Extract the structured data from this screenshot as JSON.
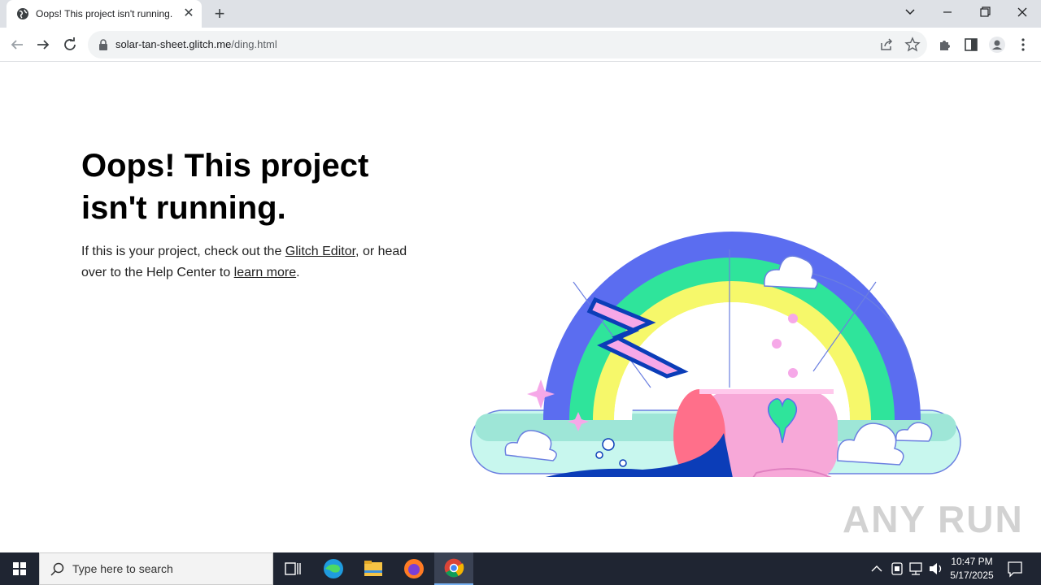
{
  "browser": {
    "tab_title": "Oops! This project isn't running.",
    "tab_close": "✕",
    "new_tab": "+",
    "url_domain": "solar-tan-sheet.glitch.me",
    "url_path": "/ding.html"
  },
  "page": {
    "headline": "Oops! This project isn't running.",
    "para_part1": "If this is your project, check out the ",
    "link_editor": "Glitch Editor",
    "para_part2": ", or head over to the Help Center to ",
    "link_learn": "learn more",
    "para_part3": "."
  },
  "watermark": "ANY RUN",
  "taskbar": {
    "search_placeholder": "Type here to search",
    "time": "10:47 PM",
    "date": "5/17/2025"
  }
}
